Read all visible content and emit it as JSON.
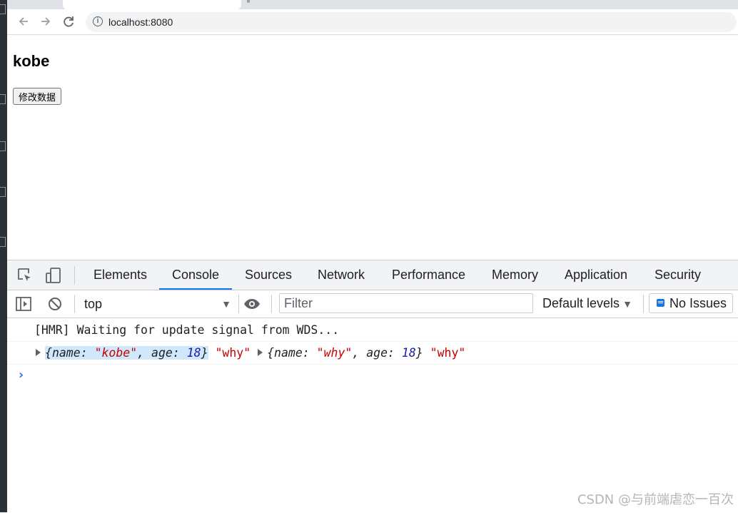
{
  "browser": {
    "url": "localhost:8080"
  },
  "page": {
    "heading": "kobe",
    "button_label": "修改数据"
  },
  "devtools": {
    "tabs": [
      "Elements",
      "Console",
      "Sources",
      "Network",
      "Performance",
      "Memory",
      "Application",
      "Security"
    ],
    "active_tab": "Console",
    "context": "top",
    "filter_placeholder": "Filter",
    "levels_label": "Default levels",
    "issues_label": "No Issues",
    "console": {
      "line1": "[HMR] Waiting for update signal from WDS...",
      "line2": {
        "obj1": {
          "open": "{",
          "k1": "name",
          "v1": "\"kobe\"",
          "sep": ", ",
          "k2": "age",
          "v2": "18",
          "close": "}"
        },
        "str1": "\"why\"",
        "obj2": {
          "open": "{",
          "k1": "name",
          "v1": "\"why\"",
          "sep": ", ",
          "k2": "age",
          "v2": "18",
          "close": "}"
        },
        "str2": "\"why\""
      },
      "prompt": "›"
    }
  },
  "watermark": "CSDN @与前端虐恋一百次",
  "colors": {
    "accent": "#1a73e8",
    "string": "#c80000",
    "number": "#1a1aa6",
    "selection": "#cfe8fc"
  }
}
